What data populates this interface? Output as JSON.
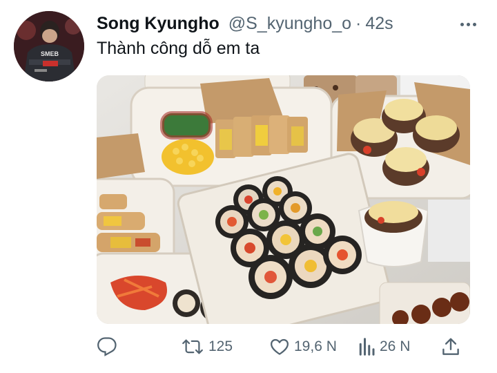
{
  "author": {
    "display_name": "Song Kyungho",
    "handle": "@S_kyungho_o",
    "separator": "·",
    "timestamp": "42s",
    "avatar_jersey_text": "SMEB"
  },
  "tweet": {
    "text": "Thành công dỗ em ta"
  },
  "media": {
    "alt": "Trays of kimbap rolls, rice burritos and cheese-topped desserts in takeout boxes"
  },
  "actions": {
    "reply_icon": "reply-icon",
    "retweet_icon": "retweet-icon",
    "retweet_count": "125",
    "like_icon": "heart-icon",
    "like_count": "19,6 N",
    "views_icon": "views-icon",
    "views_count": "26 N",
    "share_icon": "share-icon"
  },
  "colors": {
    "text_primary": "#0f1419",
    "text_secondary": "#536471"
  }
}
